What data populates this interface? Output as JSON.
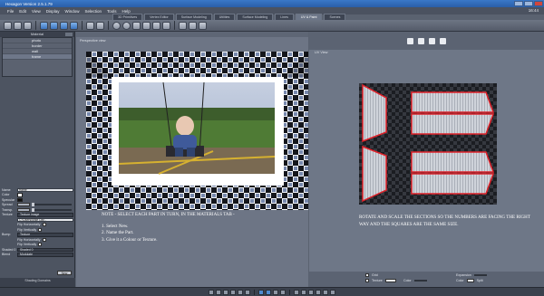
{
  "app": {
    "title": "Hexagon Version 2.5.1.79"
  },
  "menu": [
    "File",
    "Edit",
    "View",
    "Display",
    "Window",
    "Selection",
    "Tools",
    "Help"
  ],
  "tabs": [
    {
      "label": "3D Primitives",
      "active": false
    },
    {
      "label": "Vertex Editor",
      "active": false
    },
    {
      "label": "Surface Modeling",
      "active": false
    },
    {
      "label": "Utilities",
      "active": false
    },
    {
      "label": "Surface Modeling",
      "active": false
    },
    {
      "label": "Lines",
      "active": false
    },
    {
      "label": "UV & Paint",
      "active": true
    },
    {
      "label": "Scenes",
      "active": false
    }
  ],
  "clock": "16:44",
  "left_panel": {
    "header": "Material",
    "materials": [
      {
        "name": "photo",
        "selected": false
      },
      {
        "name": "border",
        "selected": false
      },
      {
        "name": "wall",
        "selected": false
      },
      {
        "name": "frame",
        "selected": true
      }
    ],
    "properties": {
      "name_label": "Name",
      "name_value": "frame",
      "color_label": "Color",
      "specular_label": "Specular",
      "spread_label": "Spread",
      "transp_label": "Transp.",
      "texture_label": "Texture",
      "texture_value": "Texture image",
      "texture_file": "C:\\Users\\Mike Dar...",
      "flip_h_label": "Flip Horizontally",
      "flip_v_label": "Flip Vertically",
      "bump_label": "Bump",
      "bump_value": "Texture",
      "bump_flip_h_label": "Flip Horizontally",
      "bump_flip_v_label": "Flip Vertically",
      "shaded_label": "Shaded 0",
      "shaded_value": "Shaded 0",
      "mode_label": "Blend",
      "mode_value": "Modulate",
      "new_button": "New"
    },
    "bottom_header": "Shading Domains"
  },
  "center_view": {
    "title": "Perspective view",
    "note_header": "NOTE - SELECT EACH PART IN TURN, IN THE MATERIALS TAB -",
    "steps": [
      "1. Select New.",
      "2. Name the Part.",
      "3. Give it a Colour or Texture."
    ]
  },
  "right_view": {
    "title": "UV View",
    "note": "ROTATE AND SCALE THE SECTIONS SO THE NUMBERS ARE FACING THE RIGHT WAY AND THE SQUARES ARE THE SAME SIZE.",
    "grid_label": "Grid",
    "texture_label": "Texture",
    "color_label": "Color",
    "expansion_label": "Expansion",
    "color_value": "Color",
    "split_value": "Split"
  },
  "colors": {
    "accent": "#3a78c8",
    "panel": "#4d5461",
    "viewport": "#6d7585",
    "uv_edge": "#e0222a"
  }
}
